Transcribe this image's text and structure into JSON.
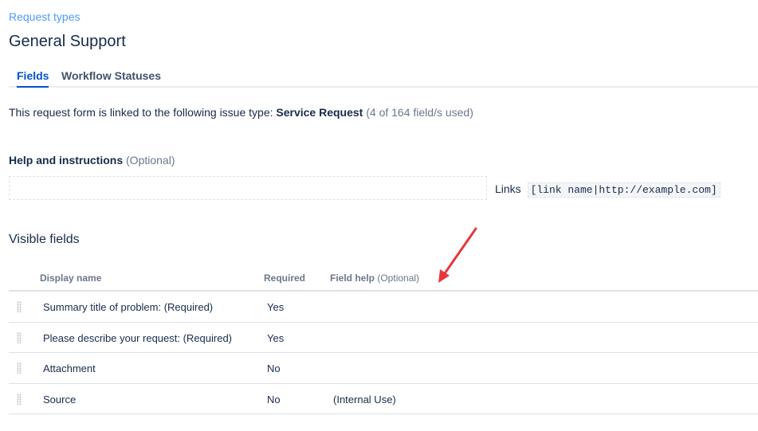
{
  "breadcrumb": "Request types",
  "title": "General Support",
  "tabs": [
    {
      "label": "Fields",
      "active": true
    },
    {
      "label": "Workflow Statuses",
      "active": false
    }
  ],
  "linked": {
    "prefix": "This request form is linked to the following issue type: ",
    "issue_type": "Service Request",
    "usage": " (4 of 164 field/s used)"
  },
  "help": {
    "label": "Help and instructions",
    "optional": " (Optional)",
    "value": "",
    "links_label": "Links",
    "links_example": "[link name|http://example.com]"
  },
  "visible_fields": {
    "title": "Visible fields",
    "columns": {
      "display_name": "Display name",
      "required": "Required",
      "field_help": "Field help",
      "field_help_optional": " (Optional)"
    },
    "rows": [
      {
        "name": "Summary title of problem: (Required)",
        "required": "Yes",
        "help": ""
      },
      {
        "name": "Please describe your request: (Required)",
        "required": "Yes",
        "help": ""
      },
      {
        "name": "Attachment",
        "required": "No",
        "help": ""
      },
      {
        "name": "Source",
        "required": "No",
        "help": "(Internal Use)"
      }
    ]
  },
  "colors": {
    "accent": "#0052cc",
    "link": "#4c9aff",
    "annotation_arrow": "#e8383d"
  }
}
